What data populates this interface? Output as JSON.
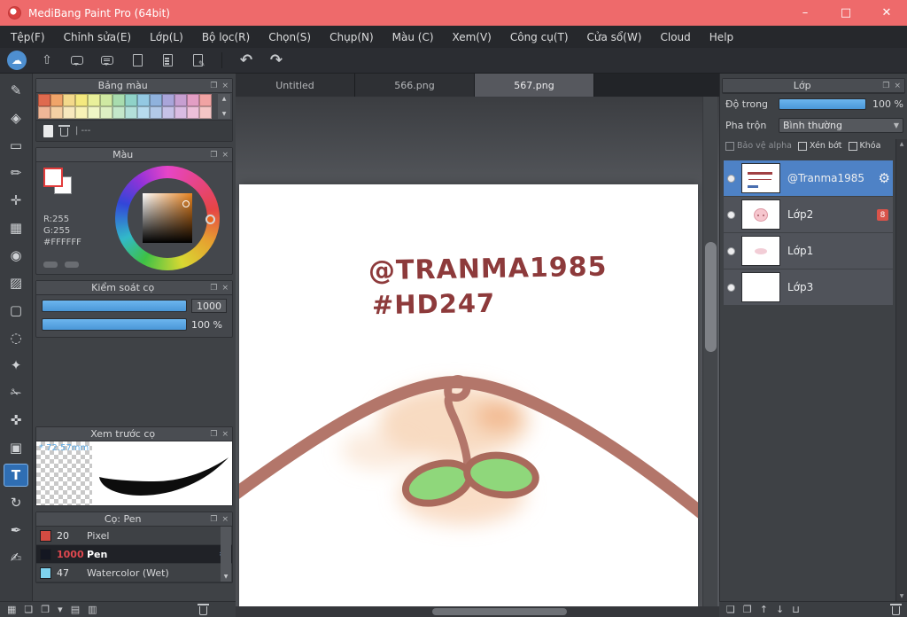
{
  "window": {
    "title": "MediBang Paint Pro (64bit)",
    "controls": {
      "minimize": "–",
      "maximize": "□",
      "close": "✕"
    }
  },
  "menu": {
    "items": [
      "Tệp(F)",
      "Chỉnh sửa(E)",
      "Lớp(L)",
      "Bộ lọc(R)",
      "Chọn(S)",
      "Chụp(N)",
      "Màu (C)",
      "Xem(V)",
      "Công cụ(T)",
      "Cửa sổ(W)",
      "Cloud",
      "Help"
    ]
  },
  "toolbar": {
    "cloud": "☁",
    "upload": "⇧",
    "undo": "↶",
    "redo": "↷"
  },
  "tools": {
    "selected": "text-tool",
    "items": [
      {
        "name": "brush-tool",
        "glyph": "✎"
      },
      {
        "name": "eraser-tool",
        "glyph": "◈"
      },
      {
        "name": "shape-brush-tool",
        "glyph": "▭"
      },
      {
        "name": "dot-pen-tool",
        "glyph": "✏"
      },
      {
        "name": "move-tool",
        "glyph": "✛"
      },
      {
        "name": "fill-rect-tool",
        "glyph": "▦"
      },
      {
        "name": "bucket-tool",
        "glyph": "◉"
      },
      {
        "name": "gradient-tool",
        "glyph": "▨"
      },
      {
        "name": "select-rect-tool",
        "glyph": "▢"
      },
      {
        "name": "select-lasso-tool",
        "glyph": "◌"
      },
      {
        "name": "magic-wand-tool",
        "glyph": "✦"
      },
      {
        "name": "select-pen-tool",
        "glyph": "✁"
      },
      {
        "name": "select-eraser-tool",
        "glyph": "✜"
      },
      {
        "name": "stamp-tool",
        "glyph": "▣"
      },
      {
        "name": "text-tool",
        "glyph": "T"
      },
      {
        "name": "rotate-tool",
        "glyph": "↻"
      },
      {
        "name": "pen-tool",
        "glyph": "✒"
      },
      {
        "name": "script-brush-tool",
        "glyph": "✍"
      }
    ]
  },
  "left_panels": {
    "palette": {
      "title": "Bảng màu",
      "row1": [
        "#df6a4e",
        "#f0a469",
        "#f3d98b",
        "#f4e97e",
        "#e9f09a",
        "#cfe9a2",
        "#a8dcae",
        "#8fd2c8",
        "#93c9e3",
        "#8fb2dd",
        "#a9a5da",
        "#c79fd1",
        "#e39ec4",
        "#f1a3a3"
      ],
      "row2": [
        "#efb697",
        "#f4d0a4",
        "#f7e8bd",
        "#f8f2b6",
        "#f0f6c6",
        "#def0c3",
        "#c4e7ca",
        "#b3e0da",
        "#b7dcef",
        "#b2c9e8",
        "#c6c2e8",
        "#dabce3",
        "#eec0da",
        "#f5c6c6"
      ],
      "note": "| ---"
    },
    "color": {
      "title": "Màu",
      "r": "R:255",
      "g": "G:255",
      "hex": "#FFFFFF"
    },
    "brush_control": {
      "title": "Kiểm soát cọ",
      "size_value": "1000",
      "opacity_value": "100 %"
    },
    "brush_preview": {
      "title": "Xem trước cọ",
      "size": "* 72.57mm"
    },
    "brushes": {
      "title": "Cọ: Pen",
      "items": [
        {
          "size": "20",
          "name": "Pixel",
          "color": "#d34b42",
          "selected": false
        },
        {
          "size": "1000",
          "name": "Pen",
          "color": "#141722",
          "selected": true
        },
        {
          "size": "47",
          "name": "Watercolor (Wet)",
          "color": "#7fd3ef",
          "selected": false
        }
      ]
    }
  },
  "tabs": [
    {
      "label": "Untitled",
      "active": false
    },
    {
      "label": "566.png",
      "active": false
    },
    {
      "label": "567.png",
      "active": true
    }
  ],
  "canvas": {
    "line1": "@TRANMA1985",
    "line2": "#HD247",
    "ink_color": "#8d3a3b"
  },
  "layers_panel": {
    "title": "Lớp",
    "opacity_label": "Độ trong",
    "opacity_value": "100 %",
    "blend_label": "Pha trộn",
    "blend_value": "Bình thường",
    "checks": [
      "Bảo vệ alpha",
      "Xén bớt",
      "Khóa"
    ],
    "layers": [
      {
        "name": "@Tranma1985",
        "selected": true
      },
      {
        "name": "Lớp2",
        "badge": "8",
        "selected": false
      },
      {
        "name": "Lớp1",
        "selected": false
      },
      {
        "name": "Lớp3",
        "selected": false
      }
    ]
  },
  "bottom_left": {
    "icons": [
      {
        "name": "transparency-toggle-icon",
        "glyph": "▦"
      },
      {
        "name": "new-canvas-icon",
        "glyph": "❏"
      },
      {
        "name": "canvas-menu-icon",
        "glyph": "❐"
      },
      {
        "name": "dropdown-icon",
        "glyph": "▾"
      },
      {
        "name": "folder-icon",
        "glyph": "▤"
      },
      {
        "name": "save-icon",
        "glyph": "▥"
      }
    ]
  },
  "bottom_right": {
    "icons": [
      {
        "name": "new-layer-icon",
        "glyph": "❏"
      },
      {
        "name": "duplicate-layer-icon",
        "glyph": "❐"
      },
      {
        "name": "layer-up-icon",
        "glyph": "↑"
      },
      {
        "name": "layer-down-icon",
        "glyph": "↓"
      },
      {
        "name": "merge-layer-icon",
        "glyph": "⊔"
      }
    ]
  }
}
